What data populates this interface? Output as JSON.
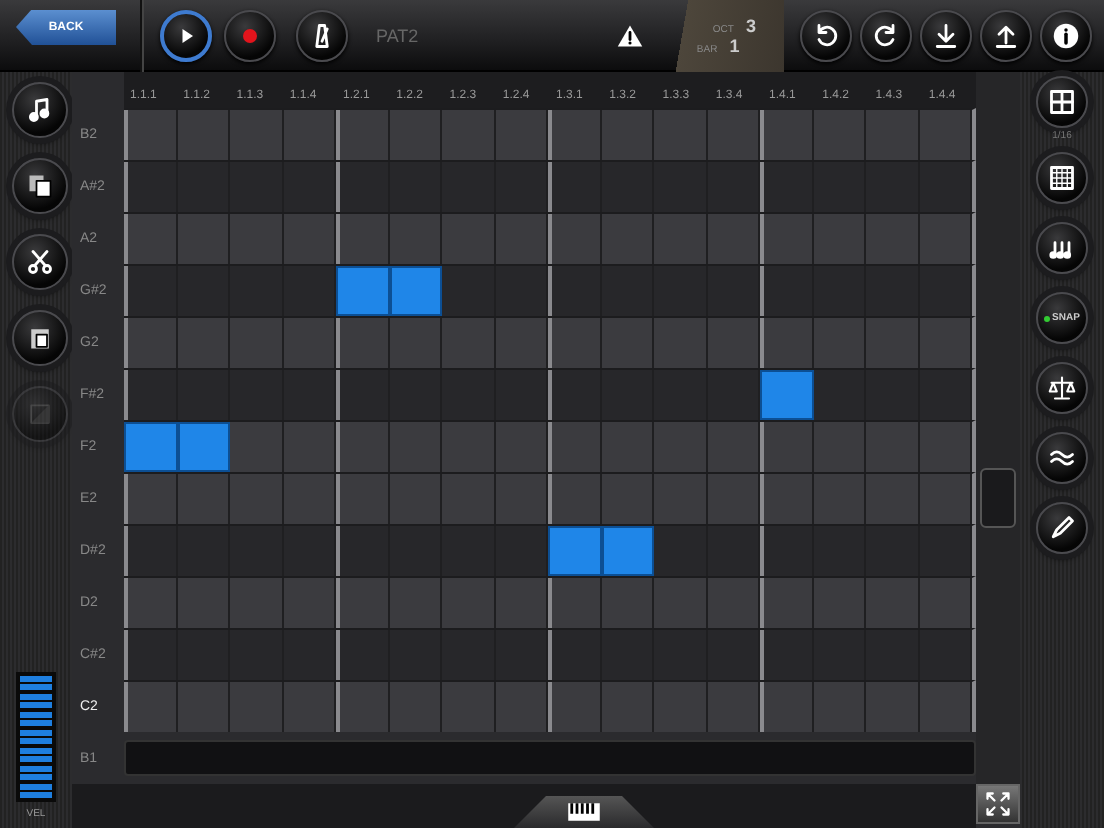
{
  "top_bar": {
    "back": "BACK",
    "transport": [
      {
        "kind": "play",
        "on": true
      },
      {
        "kind": "record",
        "on": false
      },
      {
        "kind": "metronome",
        "on": false
      }
    ],
    "pattern": "PAT2",
    "position": [
      {
        "label": "OCT",
        "value": "3"
      },
      {
        "label": "BAR",
        "value": "1"
      }
    ],
    "actions": [
      {
        "kind": "undo"
      },
      {
        "kind": "redo"
      },
      {
        "kind": "download"
      },
      {
        "kind": "upload"
      },
      {
        "kind": "info"
      }
    ]
  },
  "left_tools": [
    {
      "kind": "note",
      "disabled": false
    },
    {
      "kind": "copy",
      "disabled": false
    },
    {
      "kind": "cut",
      "disabled": false
    },
    {
      "kind": "paste",
      "disabled": false
    },
    {
      "kind": "select",
      "disabled": true
    }
  ],
  "velocity": {
    "label": "VEL",
    "level": 1
  },
  "ruler": [
    "1.1.1",
    "1.1.2",
    "1.1.3",
    "1.1.4",
    "1.2.1",
    "1.2.2",
    "1.2.3",
    "1.2.4",
    "1.3.1",
    "1.3.2",
    "1.3.3",
    "1.3.4",
    "1.4.1",
    "1.4.2",
    "1.4.3",
    "1.4.4"
  ],
  "rows": [
    {
      "label": "B2",
      "kind": "white",
      "accent": false,
      "steps": [
        false,
        false,
        false,
        false,
        false,
        false,
        false,
        false,
        false,
        false,
        false,
        false,
        false,
        false,
        false,
        false
      ]
    },
    {
      "label": "A#2",
      "kind": "black",
      "accent": false,
      "steps": [
        false,
        false,
        false,
        false,
        false,
        false,
        false,
        false,
        false,
        false,
        false,
        false,
        false,
        false,
        false,
        false
      ]
    },
    {
      "label": "A2",
      "kind": "white",
      "accent": false,
      "steps": [
        false,
        false,
        false,
        false,
        false,
        false,
        false,
        false,
        false,
        false,
        false,
        false,
        false,
        false,
        false,
        false
      ]
    },
    {
      "label": "G#2",
      "kind": "black",
      "accent": false,
      "steps": [
        false,
        false,
        false,
        false,
        true,
        true,
        false,
        false,
        false,
        false,
        false,
        false,
        false,
        false,
        false,
        false
      ]
    },
    {
      "label": "G2",
      "kind": "white",
      "accent": false,
      "steps": [
        false,
        false,
        false,
        false,
        false,
        false,
        false,
        false,
        false,
        false,
        false,
        false,
        false,
        false,
        false,
        false
      ]
    },
    {
      "label": "F#2",
      "kind": "black",
      "accent": false,
      "steps": [
        false,
        false,
        false,
        false,
        false,
        false,
        false,
        false,
        false,
        false,
        false,
        false,
        true,
        false,
        false,
        false
      ]
    },
    {
      "label": "F2",
      "kind": "white",
      "accent": false,
      "steps": [
        true,
        true,
        false,
        false,
        false,
        false,
        false,
        false,
        false,
        false,
        false,
        false,
        false,
        false,
        false,
        false
      ]
    },
    {
      "label": "E2",
      "kind": "white",
      "accent": false,
      "steps": [
        false,
        false,
        false,
        false,
        false,
        false,
        false,
        false,
        false,
        false,
        false,
        false,
        false,
        false,
        false,
        false
      ]
    },
    {
      "label": "D#2",
      "kind": "black",
      "accent": false,
      "steps": [
        false,
        false,
        false,
        false,
        false,
        false,
        false,
        false,
        true,
        true,
        false,
        false,
        false,
        false,
        false,
        false
      ]
    },
    {
      "label": "D2",
      "kind": "white",
      "accent": false,
      "steps": [
        false,
        false,
        false,
        false,
        false,
        false,
        false,
        false,
        false,
        false,
        false,
        false,
        false,
        false,
        false,
        false
      ]
    },
    {
      "label": "C#2",
      "kind": "black",
      "accent": false,
      "steps": [
        false,
        false,
        false,
        false,
        false,
        false,
        false,
        false,
        false,
        false,
        false,
        false,
        false,
        false,
        false,
        false
      ]
    },
    {
      "label": "C2",
      "kind": "white",
      "accent": true,
      "steps": [
        false,
        false,
        false,
        false,
        false,
        false,
        false,
        false,
        false,
        false,
        false,
        false,
        false,
        false,
        false,
        false
      ]
    }
  ],
  "hidden_row": {
    "label": "B1"
  },
  "right_tools": [
    {
      "kind": "grid4",
      "caption": "1/16"
    },
    {
      "kind": "grid16"
    },
    {
      "kind": "notes"
    },
    {
      "kind": "snap",
      "label": "SNAP",
      "on": true
    },
    {
      "kind": "balance"
    },
    {
      "kind": "wave"
    },
    {
      "kind": "pencil"
    }
  ]
}
